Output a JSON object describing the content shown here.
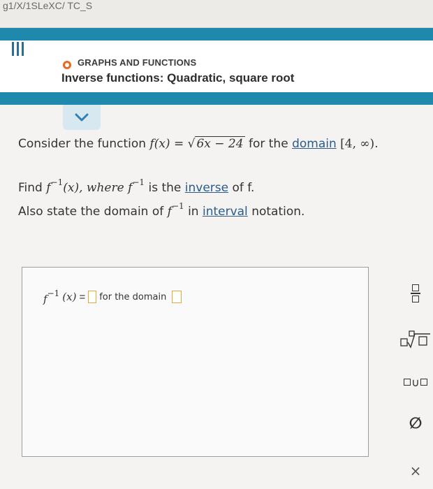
{
  "browser": {
    "url_fragment": "g1/X/1SLeXC/ TC_S"
  },
  "header": {
    "topic": "GRAPHS AND FUNCTIONS",
    "title": "Inverse functions: Quadratic, square root"
  },
  "problem": {
    "line1_prefix": "Consider the function",
    "function_lhs": "f(x) =",
    "radicand": "6x − 24",
    "line1_mid": "for the",
    "domain_link": "domain",
    "domain_value": "[4, ∞).",
    "line2_find": "Find",
    "line2_finv": "f",
    "line2_args": "(x), where",
    "line2_finv2": "f",
    "line2_is": "is the",
    "inverse_link": "inverse",
    "line2_end": "of f.",
    "line3_prefix": "Also state the domain of",
    "line3_finv": "f",
    "line3_in": "in",
    "interval_link": "interval",
    "line3_end": "notation.",
    "sup_minus_one": "−1"
  },
  "answer": {
    "lhs": "f",
    "sup": "−1",
    "arg": "(x)",
    "equals": "=",
    "for_domain": "for the domain"
  },
  "tools": {
    "infinity": "∅",
    "union": "∪",
    "close": "×"
  },
  "colors": {
    "header_bar": "#1f88ad",
    "topic_dot": "#e86a1e",
    "link": "#2b5c8a",
    "answer_blank": "#e0a93a"
  }
}
